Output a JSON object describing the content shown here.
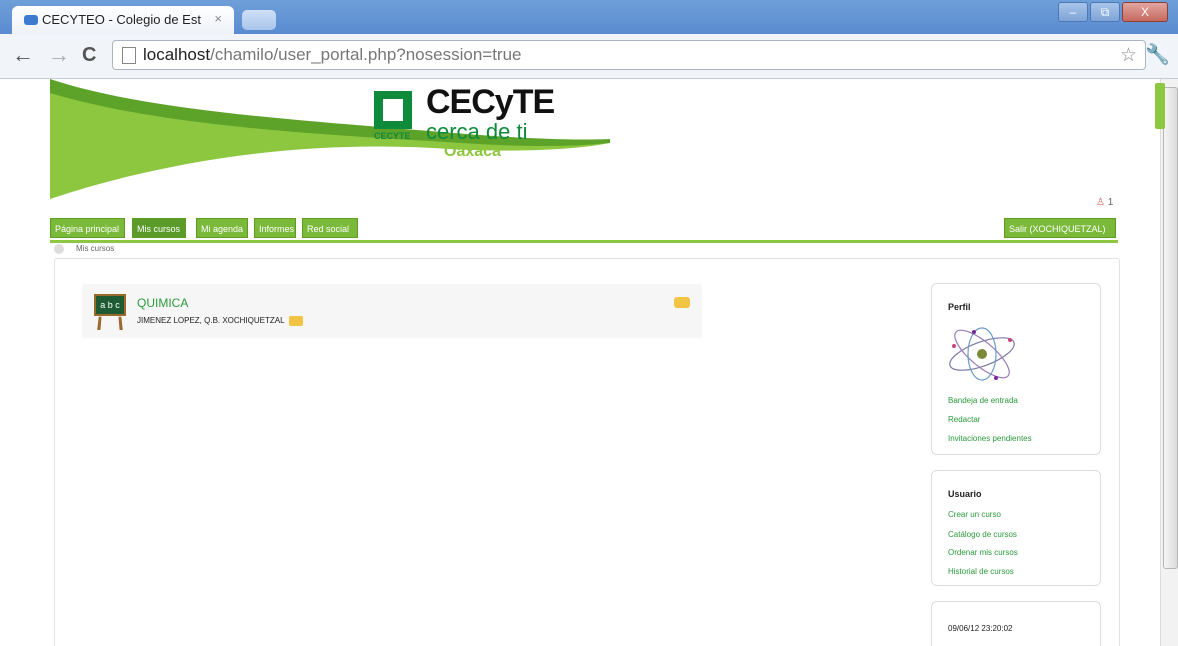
{
  "browser": {
    "tab_title": "CECYTEO - Colegio de Est",
    "tab_close": "×",
    "url_host": "localhost",
    "url_path": "/chamilo/user_portal.php?nosession=true",
    "back_icon": "←",
    "forward_icon": "→",
    "reload_icon": "C",
    "star_icon": "☆",
    "wrench_icon": "🔧",
    "minimize": "–",
    "restore": "⧉",
    "close": "X"
  },
  "header": {
    "logo_title": "CECyTE",
    "logo_subtitle": "cerca de ti",
    "logo_city": "Oaxaca",
    "logo_small": "CECYTE",
    "user_count": "1"
  },
  "nav": {
    "tabs": [
      {
        "label": "Página principal"
      },
      {
        "label": "Mis cursos"
      },
      {
        "label": "Mi agenda"
      },
      {
        "label": "Informes"
      },
      {
        "label": "Red social"
      }
    ],
    "logout_label": "Salir (XOCHIQUETZAL)"
  },
  "breadcrumb": {
    "current": "Mis cursos"
  },
  "course": {
    "title": "QUIMICA",
    "teacher": "JIMENEZ LOPEZ, Q.B. XOCHIQUETZAL",
    "icon_text": "a b c"
  },
  "sidebar": {
    "profile": {
      "title": "Perfil",
      "links": [
        "Bandeja de entrada",
        "Redactar",
        "Invitaciones pendientes"
      ]
    },
    "user": {
      "title": "Usuario",
      "links": [
        "Crear un curso",
        "Catálogo de cursos",
        "Ordenar mis cursos",
        "Historial de cursos"
      ]
    },
    "datetime": "09/06/12 23:20:02"
  },
  "colors": {
    "brand_green": "#8dc63f",
    "dark_green": "#0e8a3b",
    "link_green": "#2a9a3a"
  }
}
